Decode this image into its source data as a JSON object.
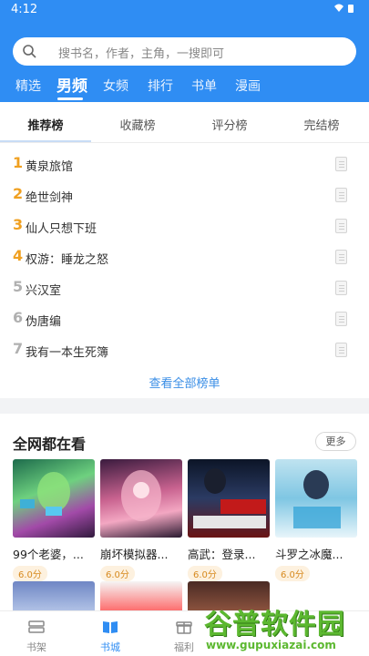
{
  "status": {
    "time": "4:12"
  },
  "search": {
    "placeholder": "搜书名，作者，主角，一搜即可"
  },
  "tabs": [
    "精选",
    "男频",
    "女频",
    "排行",
    "书单",
    "漫画"
  ],
  "rank_tabs": [
    "推荐榜",
    "收藏榜",
    "评分榜",
    "完结榜"
  ],
  "ranking": [
    {
      "num": "1",
      "title": "黄泉旅馆"
    },
    {
      "num": "2",
      "title": "绝世剑神"
    },
    {
      "num": "3",
      "title": "仙人只想下班"
    },
    {
      "num": "4",
      "title": "权游：睡龙之怒"
    },
    {
      "num": "5",
      "title": "兴汉室"
    },
    {
      "num": "6",
      "title": "伪唐编"
    },
    {
      "num": "7",
      "title": "我有一本生死簿"
    }
  ],
  "view_all": "查看全部榜单",
  "section": {
    "title": "全网都在看",
    "more": "更多"
  },
  "books": [
    {
      "title": "99个老婆，...",
      "score": "6.0分"
    },
    {
      "title": "崩坏模拟器...",
      "score": "6.0分"
    },
    {
      "title": "高武：登录...",
      "score": "6.0分"
    },
    {
      "title": "斗罗之冰魔...",
      "score": "6.0分"
    }
  ],
  "nav": [
    {
      "label": "书架"
    },
    {
      "label": "书城"
    },
    {
      "label": "福利"
    }
  ],
  "watermark": {
    "title": "谷普软件园",
    "url": "www.gupuxiazai.com"
  },
  "colors": {
    "primary": "#2f8df3",
    "rank_gold": "#f0a020",
    "rank_gray": "#b0b0b0"
  }
}
